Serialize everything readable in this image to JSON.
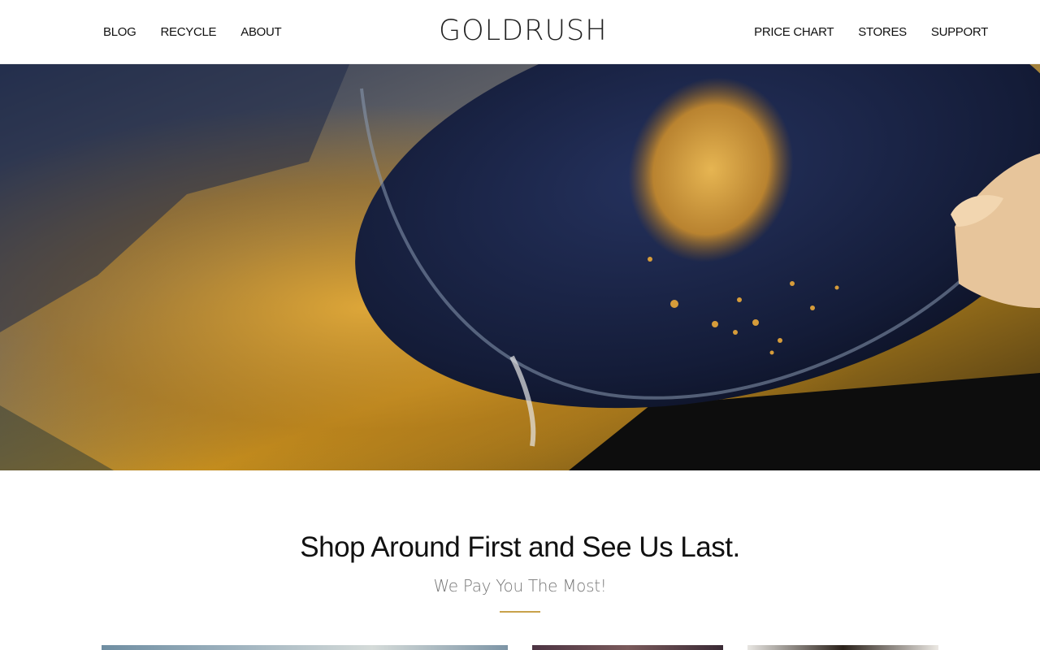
{
  "header": {
    "logo_text": "GOLDRUSH",
    "nav_left": [
      {
        "label": "BLOG"
      },
      {
        "label": "RECYCLE"
      },
      {
        "label": "ABOUT"
      }
    ],
    "nav_right": [
      {
        "label": "PRICE CHART"
      },
      {
        "label": "STORES"
      },
      {
        "label": "SUPPORT"
      }
    ]
  },
  "hero": {
    "image": "gold-panning-photo"
  },
  "intro": {
    "heading": "Shop Around First and See Us Last.",
    "subheading": "We Pay You The Most!"
  },
  "gallery": {
    "items": [
      {
        "image": "gold-jewelry-photo"
      },
      {
        "image": "gold-bars-photo"
      },
      {
        "image": "gold-coin-photo"
      }
    ]
  },
  "colors": {
    "accent": "#c8a24a",
    "text": "#111111",
    "muted": "#777777"
  }
}
